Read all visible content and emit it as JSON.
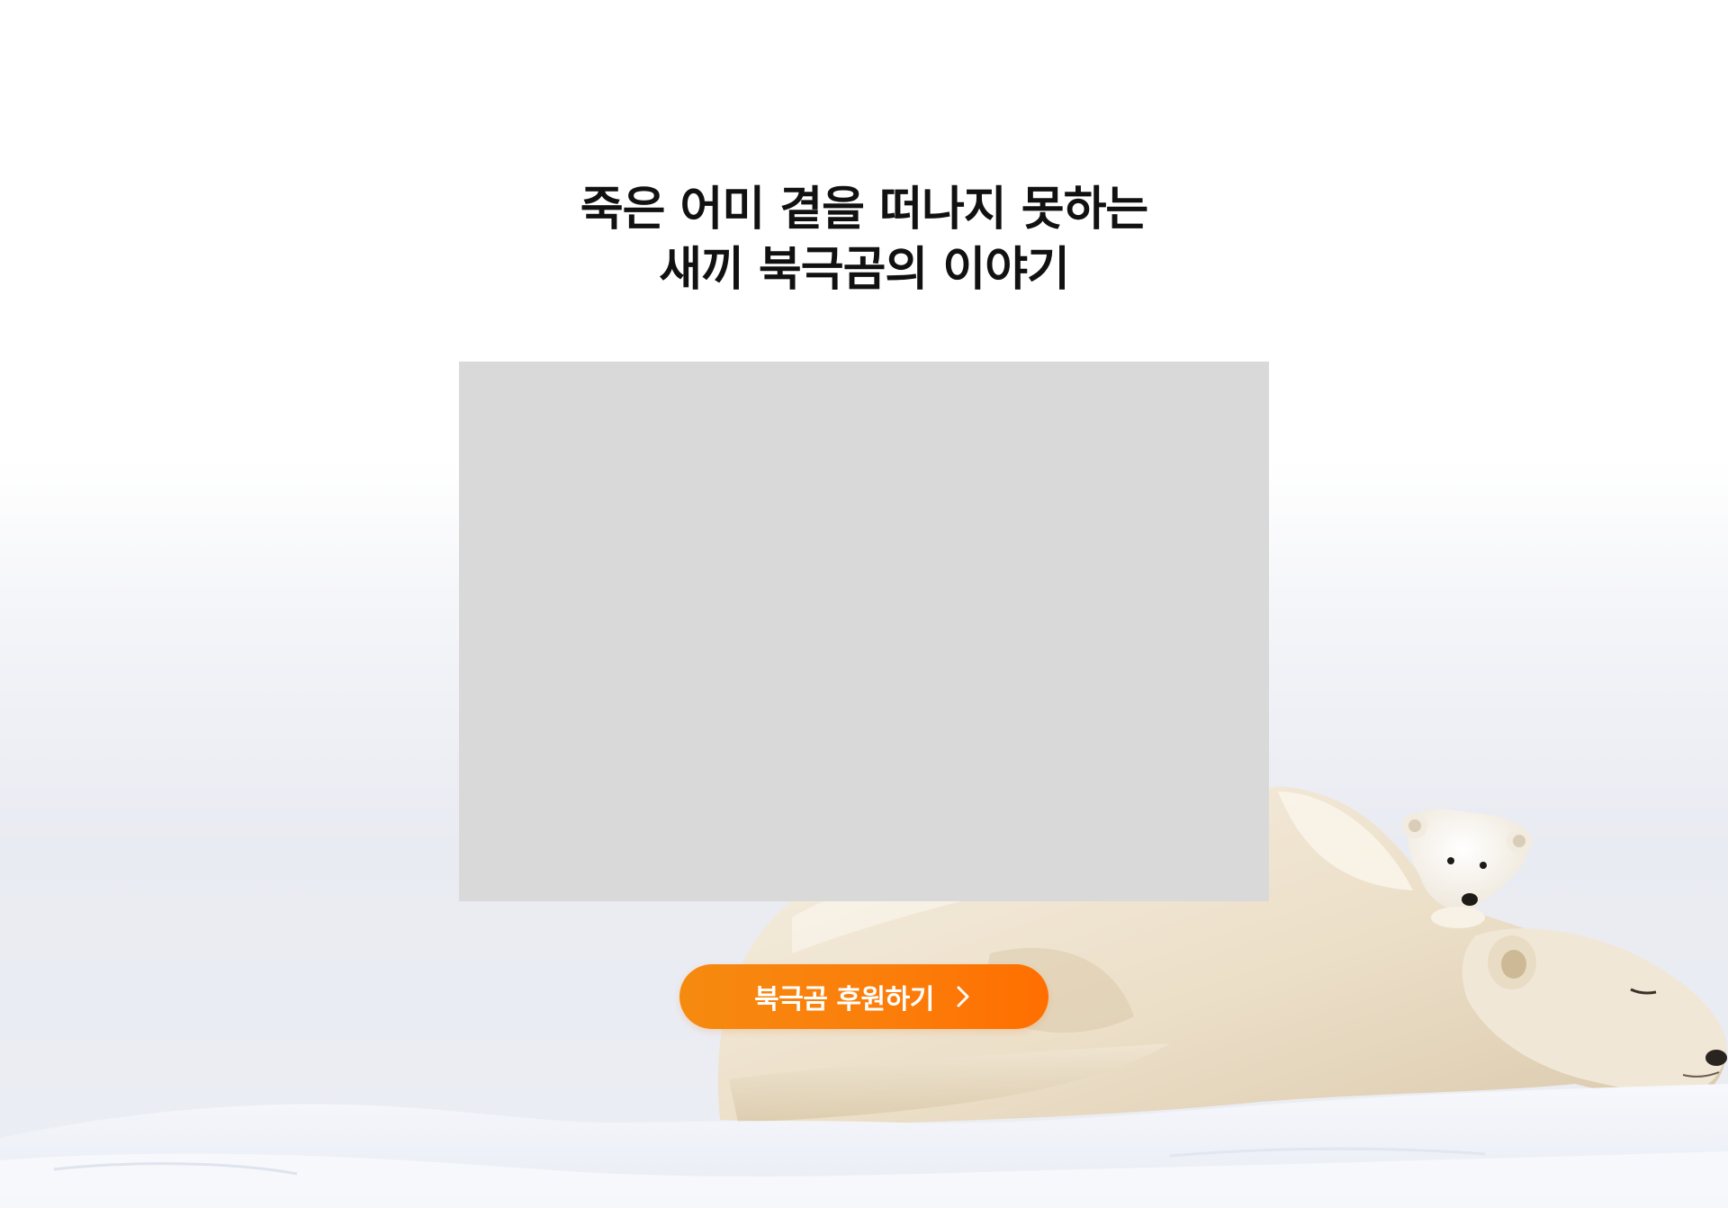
{
  "headline": {
    "line1": "죽은 어미 곁을 떠나지 못하는",
    "line2": "새끼 북극곰의 이야기"
  },
  "cta": {
    "label": "북극곰 후원하기",
    "icon": "chevron-right-icon"
  },
  "colors": {
    "cta_start": "#f68a0f",
    "cta_end": "#ff6f00",
    "headline": "#111111",
    "video_placeholder": "#d9d9d9"
  }
}
